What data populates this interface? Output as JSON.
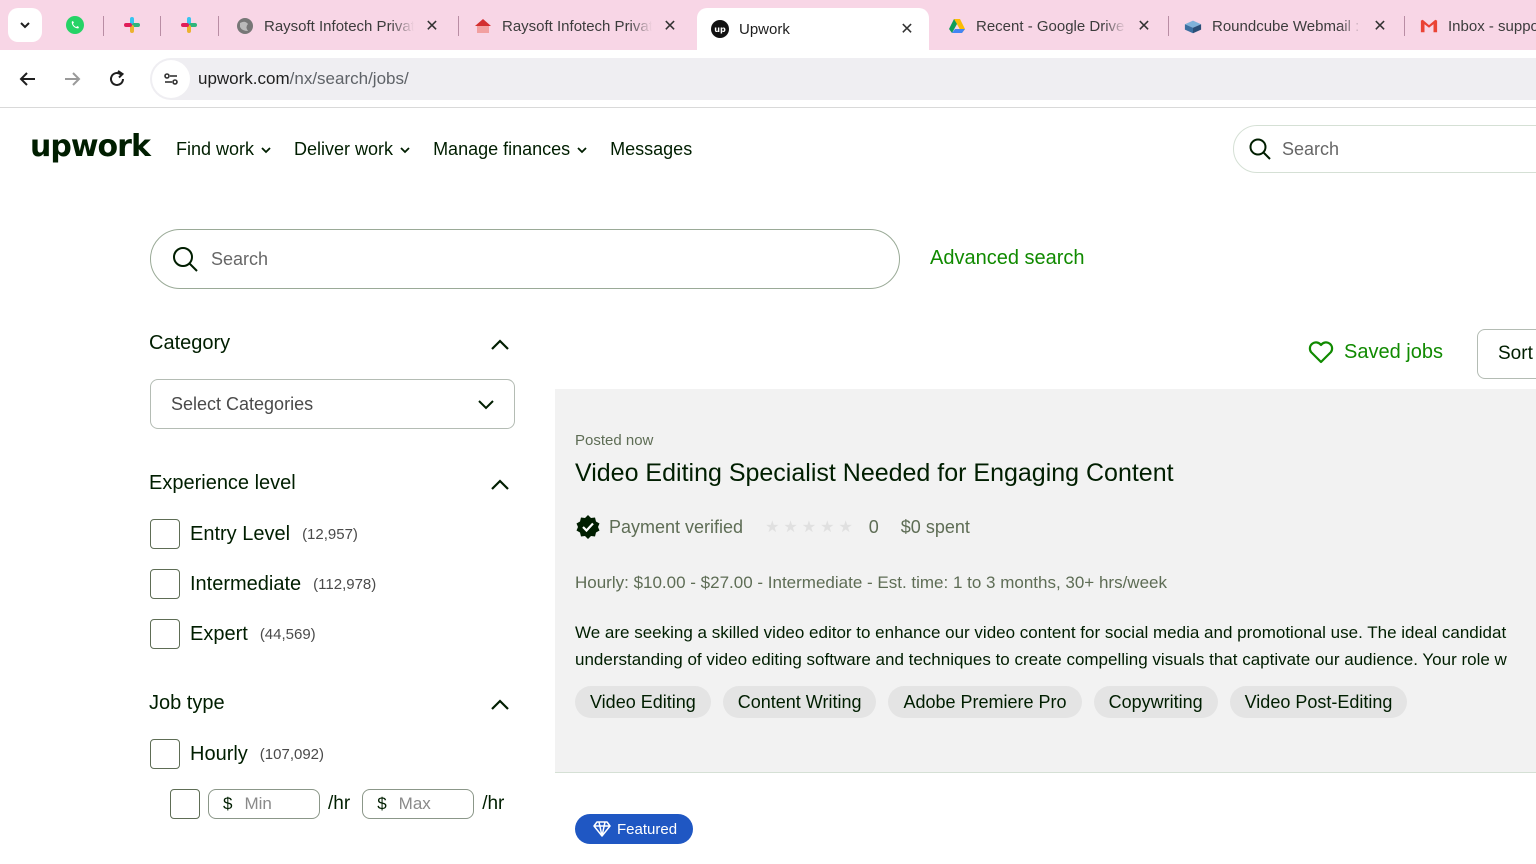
{
  "browser": {
    "tabs": [
      {
        "title": "Raysoft Infotech Privat",
        "icon": "globe-icon"
      },
      {
        "title": "Raysoft Infotech Privat",
        "icon": "raysoft-icon"
      },
      {
        "title": "Upwork",
        "icon": "upwork-icon",
        "active": true
      },
      {
        "title": "Recent - Google Drive",
        "icon": "google-drive-icon"
      },
      {
        "title": "Roundcube Webmail :",
        "icon": "roundcube-icon"
      },
      {
        "title": "Inbox - suppo",
        "icon": "gmail-icon"
      }
    ],
    "url_host": "upwork.com",
    "url_path": "/nx/search/jobs/"
  },
  "header": {
    "logo": "upwork",
    "nav": [
      "Find work",
      "Deliver work",
      "Manage finances",
      "Messages"
    ],
    "search_placeholder": "Search"
  },
  "search": {
    "placeholder": "Search",
    "advanced_label": "Advanced search"
  },
  "filters": {
    "category": {
      "title": "Category",
      "select_placeholder": "Select Categories"
    },
    "experience": {
      "title": "Experience level",
      "options": [
        {
          "label": "Entry Level",
          "count": "(12,957)"
        },
        {
          "label": "Intermediate",
          "count": "(112,978)"
        },
        {
          "label": "Expert",
          "count": "(44,569)"
        }
      ]
    },
    "job_type": {
      "title": "Job type",
      "hourly": {
        "label": "Hourly",
        "count": "(107,092)"
      },
      "currency": "$",
      "min_placeholder": "Min",
      "max_placeholder": "Max",
      "unit": "/hr"
    }
  },
  "results": {
    "saved_jobs_label": "Saved jobs",
    "sort_label": "Sort",
    "job": {
      "posted": "Posted now",
      "title": "Video Editing Specialist Needed for Engaging Content",
      "payment": "Payment verified",
      "rating": "0",
      "spent": "$0 spent",
      "meta": "Hourly: $10.00 - $27.00 - Intermediate - Est. time: 1 to 3 months, 30+ hrs/week",
      "desc_line1": "We are seeking a skilled video editor to enhance our video content for social media and promotional use. The ideal candidat",
      "desc_line2": "understanding of video editing software and techniques to create compelling visuals that captivate our audience. Your role w",
      "skills": [
        "Video Editing",
        "Content Writing",
        "Adobe Premiere Pro",
        "Copywriting",
        "Video Post-Editing"
      ]
    },
    "featured_label": "Featured"
  },
  "colors": {
    "brand_green": "#108a00",
    "text_dark": "#001e00",
    "featured_blue": "#1f57c3",
    "tabbar_pink": "#f8d6e6"
  }
}
